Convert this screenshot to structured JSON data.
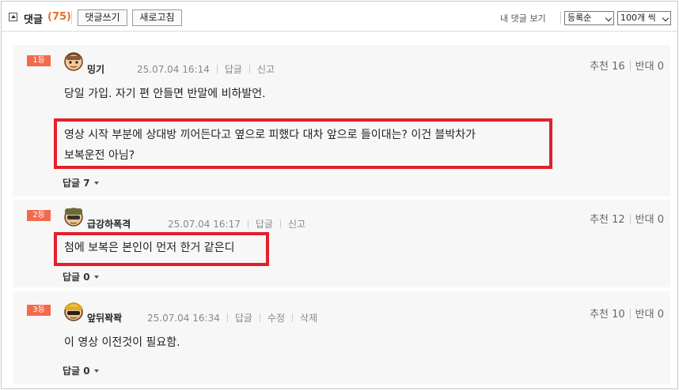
{
  "header": {
    "title": "댓글",
    "count": "(75)",
    "write_label": "댓글쓰기",
    "refresh_label": "새로고침",
    "my_comments_label": "내 댓글 보기",
    "sort_selected": "등록순",
    "per_page_selected": "100개 씩"
  },
  "comments": [
    {
      "rank": "1등",
      "nickname": "밍기",
      "date": "25.07.04 16:14",
      "actions": [
        "답글",
        "신고"
      ],
      "recommend": "추천 16",
      "oppose": "반대 0",
      "lines": [
        "당일 가입. 자기 편 안들면 반말에 비하발언."
      ],
      "highlight_lines": [
        "영상 시작 부분에 상대방 끼어든다고 옆으로 피했다 대차 앞으로 들이대는? 이건 블박차가",
        "보복운전 아님?"
      ],
      "replies": "답글 7"
    },
    {
      "rank": "2등",
      "nickname": "급강하폭격",
      "date": "25.07.04 16:17",
      "actions": [
        "답글",
        "신고"
      ],
      "recommend": "추천 12",
      "oppose": "반대 0",
      "highlight_lines": [
        "첨에 보복은 본인이 먼저 한거 같은디"
      ],
      "replies": "답글 0"
    },
    {
      "rank": "3등",
      "nickname": "앞뒤꽉꽉",
      "date": "25.07.04 16:34",
      "actions": [
        "답글",
        "수정",
        "삭제"
      ],
      "recommend": "추천 10",
      "oppose": "반대 0",
      "lines": [
        "이 영상 이전것이 필요함."
      ],
      "replies": "답글 0"
    }
  ],
  "colors": {
    "rank_badge": "#f26a4b",
    "count": "#e5702a",
    "highlight_box": "#e3202b"
  }
}
